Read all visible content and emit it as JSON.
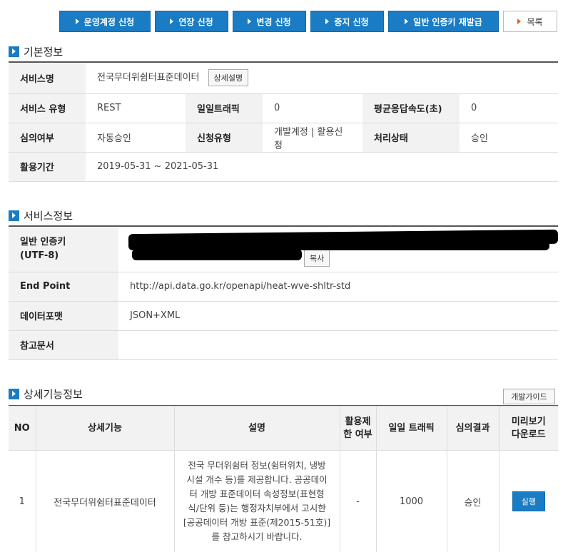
{
  "actions": {
    "operation_account": "운영계정 신청",
    "extend": "연장 신청",
    "change": "변경 신청",
    "stop": "중지 신청",
    "reissue_key": "일반 인증키 재발급",
    "list": "목록"
  },
  "basic_info": {
    "section_title": "기본정보",
    "service_name_label": "서비스명",
    "service_name": "전국무더위쉼터표준데이터",
    "detail_button": "상세설명",
    "service_type_label": "서비스 유형",
    "service_type": "REST",
    "daily_traffic_label": "일일트래픽",
    "daily_traffic": "0",
    "avg_response_label": "평균응답속도(초)",
    "avg_response": "0",
    "review_label": "심의여부",
    "review": "자동승인",
    "request_type_label": "신청유형",
    "request_type": "개발계정 | 활용신청",
    "status_label": "처리상태",
    "status": "승인",
    "period_label": "활용기간",
    "period": "2019-05-31 ~ 2021-05-31"
  },
  "service_info": {
    "section_title": "서비스정보",
    "key_label_1": "일반 인증키",
    "key_label_2": "(UTF-8)",
    "copy_button": "복사",
    "endpoint_label": "End Point",
    "endpoint": "http://api.data.go.kr/openapi/heat-wve-shltr-std",
    "format_label": "데이터포맷",
    "format": "JSON+XML",
    "reference_label": "참고문서",
    "reference": ""
  },
  "detail_info": {
    "section_title": "상세기능정보",
    "guide_button": "개발가이드",
    "headers": {
      "no": "NO",
      "function": "상세기능",
      "description": "설명",
      "restriction_1": "활용제",
      "restriction_2": "한 여부",
      "traffic": "일일 트래픽",
      "result": "심의결과",
      "preview_1": "미리보기",
      "preview_2": "다운로드"
    },
    "rows": [
      {
        "no": "1",
        "function": "전국무더위쉼터표준데이터",
        "description_lines": [
          "전국 무더위쉼터 정보(쉼터위치, 냉방",
          "시설 개수 등)를 제공합니다. 공공데이",
          "터 개방 표준데이터 속성정보(표현형",
          "식/단위 등)는 행정자치부에서 고시한",
          "[공공데이터 개방 표준(제2015-51호)]",
          "를 참고하시기 바랍니다."
        ],
        "restriction": "-",
        "traffic": "1000",
        "result": "승인",
        "run_button": "실행"
      }
    ]
  },
  "colors": {
    "primary": "#1a7cc4",
    "accent_arrow": "#e2611f",
    "header_bg": "#f2f2f2"
  }
}
